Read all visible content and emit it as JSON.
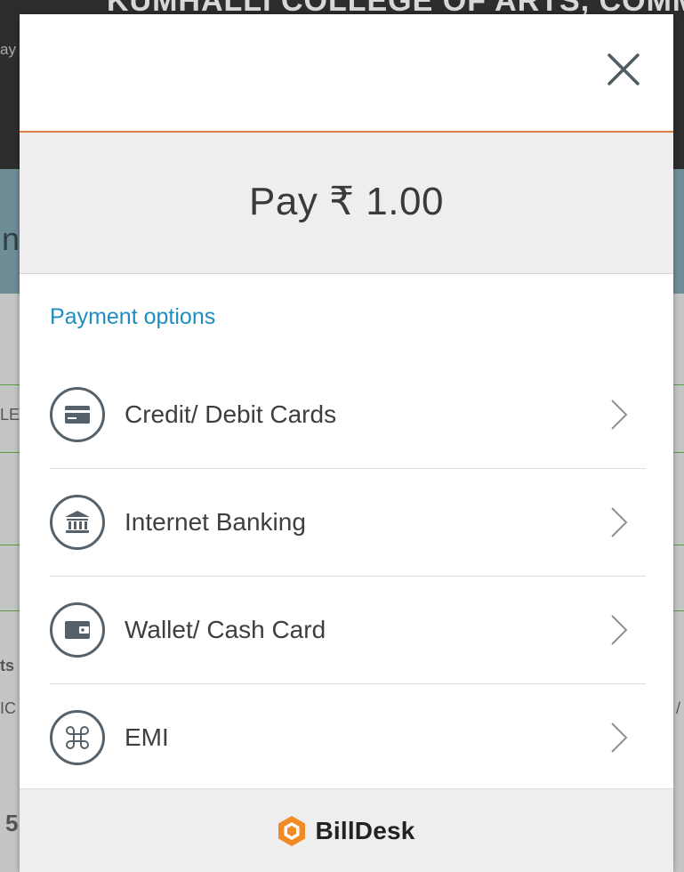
{
  "background": {
    "banner_text": "KUMHALLI COLLEGE OF ARTS, COMMERCE AND S",
    "left_snippet": "ay",
    "band_text": "nt",
    "fragments": [
      "LE",
      "ts",
      "IC",
      "/",
      "5"
    ]
  },
  "modal": {
    "close_icon": "close-icon",
    "pay_label": "Pay ₹ 1.00",
    "options_title": "Payment options",
    "options": [
      {
        "icon": "card-icon",
        "label": "Credit/ Debit Cards"
      },
      {
        "icon": "bank-icon",
        "label": "Internet Banking"
      },
      {
        "icon": "wallet-icon",
        "label": "Wallet/ Cash Card"
      },
      {
        "icon": "command-icon",
        "label": "EMI"
      }
    ],
    "footer": {
      "brand_name": "BillDesk",
      "logo_icon": "billdesk-logo-icon"
    }
  },
  "colors": {
    "accent_line": "#e07b4a",
    "options_title": "#1d8ebf",
    "logo_orange": "#f08a24"
  }
}
